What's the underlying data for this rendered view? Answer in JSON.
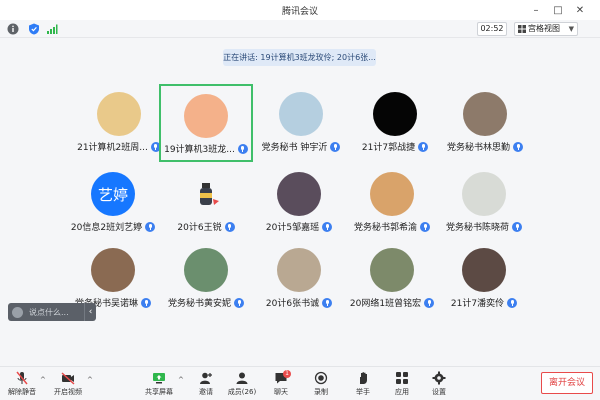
{
  "window": {
    "title": "腾讯会议"
  },
  "infobar": {
    "timer": "02:52",
    "view_label": "宫格视图"
  },
  "speaking": "正在讲话: 19计算机3班龙玫伶; 20计6张...",
  "participants": [
    {
      "name": "21计算机2班周...",
      "avatar_color": "#e9c98a",
      "kind": "image"
    },
    {
      "name": "19计算机3班龙...",
      "avatar_color": "#f4b18a",
      "kind": "image",
      "active": true
    },
    {
      "name": "党务秘书  钟宇沂",
      "avatar_color": "#b5cfe0",
      "kind": "image"
    },
    {
      "name": "21计7郭战捷",
      "avatar_color": "#050505",
      "kind": "image"
    },
    {
      "name": "党务秘书林思勤",
      "avatar_color": "#8d7a6a",
      "kind": "image"
    },
    {
      "name": "20信息2班刘艺婷",
      "avatar_color": "#1677ff",
      "kind": "initials",
      "initials": "艺婷"
    },
    {
      "name": "20计6王锐",
      "avatar_color": "#f5f6f8",
      "kind": "image"
    },
    {
      "name": "20计5邹嘉瑶",
      "avatar_color": "#5a4d5c",
      "kind": "image"
    },
    {
      "name": "党务秘书郭希渝",
      "avatar_color": "#d9a36a",
      "kind": "image"
    },
    {
      "name": "党务秘书陈晓荷",
      "avatar_color": "#d8dbd6",
      "kind": "image"
    },
    {
      "name": "党务秘书吴诺琳",
      "avatar_color": "#8a6a52",
      "kind": "image"
    },
    {
      "name": "党务秘书黄安妮",
      "avatar_color": "#6b8f6e",
      "kind": "image"
    },
    {
      "name": "20计6张书诚",
      "avatar_color": "#b9a892",
      "kind": "image"
    },
    {
      "name": "20网络1班曾铭宏",
      "avatar_color": "#7d8a6a",
      "kind": "image"
    },
    {
      "name": "21计7潘奕伶",
      "avatar_color": "#5c4a44",
      "kind": "image"
    }
  ],
  "chat": {
    "placeholder": "说点什么..."
  },
  "toolbar": {
    "unmute": "解除静音",
    "start_video": "开启视频",
    "share_screen": "共享屏幕",
    "invite": "邀请",
    "members": "成员(26)",
    "chat": "聊天",
    "chat_badge": "1",
    "record": "录制",
    "raise_hand": "举手",
    "apps": "应用",
    "settings": "设置",
    "leave": "离开会议"
  },
  "colors": {
    "accent": "#3c7ff0",
    "active_border": "#3fbf6a",
    "leave": "#e14040"
  }
}
